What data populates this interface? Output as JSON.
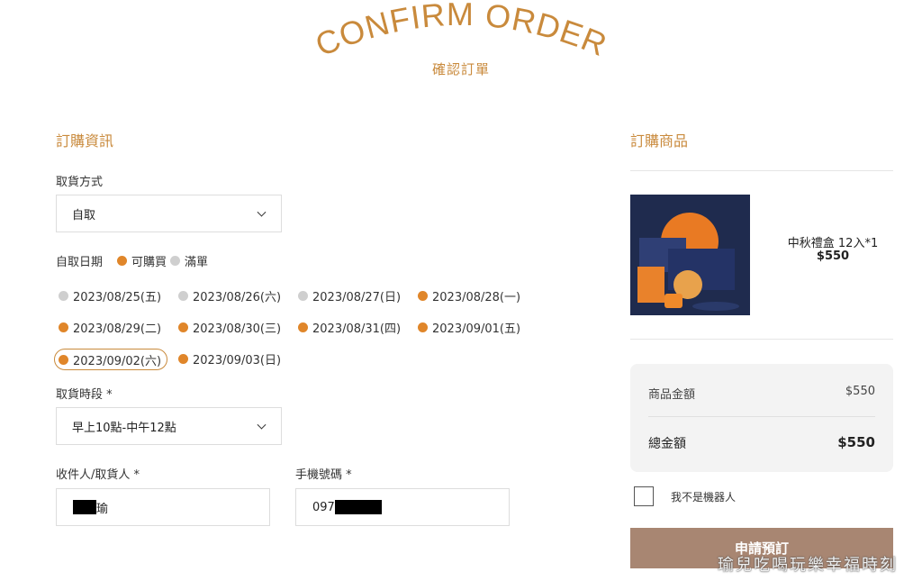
{
  "header": {
    "title": "CONFIRM ORDER",
    "subtitle": "確認訂單"
  },
  "order_info": {
    "section_title": "訂購資訊",
    "pickup_method": {
      "label": "取貨方式",
      "value": "自取"
    },
    "pickup_date": {
      "label": "自取日期",
      "legend_available": "可購買",
      "legend_full": "滿單",
      "dates": [
        {
          "text": "2023/08/25(五)",
          "status": "full"
        },
        {
          "text": "2023/08/26(六)",
          "status": "full"
        },
        {
          "text": "2023/08/27(日)",
          "status": "full"
        },
        {
          "text": "2023/08/28(一)",
          "status": "available"
        },
        {
          "text": "2023/08/29(二)",
          "status": "available"
        },
        {
          "text": "2023/08/30(三)",
          "status": "available"
        },
        {
          "text": "2023/08/31(四)",
          "status": "available"
        },
        {
          "text": "2023/09/01(五)",
          "status": "available"
        },
        {
          "text": "2023/09/02(六)",
          "status": "available",
          "selected": true
        },
        {
          "text": "2023/09/03(日)",
          "status": "available"
        }
      ]
    },
    "pickup_time": {
      "label": "取貨時段 *",
      "value": "早上10點-中午12點"
    },
    "recipient": {
      "label": "收件人/取貨人 *",
      "value_visible": "瑜"
    },
    "phone": {
      "label": "手機號碼 *",
      "value_visible": "097"
    }
  },
  "cart": {
    "section_title": "訂購商品",
    "item": {
      "name": "中秋禮盒 12入*1",
      "price": "$550"
    },
    "summary": {
      "subtotal_label": "商品金額",
      "subtotal_value": "$550",
      "total_label": "總金額",
      "total_value": "$550"
    },
    "captcha_label": "我不是機器人",
    "submit_label": "申請預訂"
  },
  "watermark": "瑜兒吃喝玩樂幸福時刻",
  "colors": {
    "accent": "#c98a3c",
    "available": "#e0862a",
    "full": "#cfcfcf",
    "submit_bg": "#a88672"
  }
}
